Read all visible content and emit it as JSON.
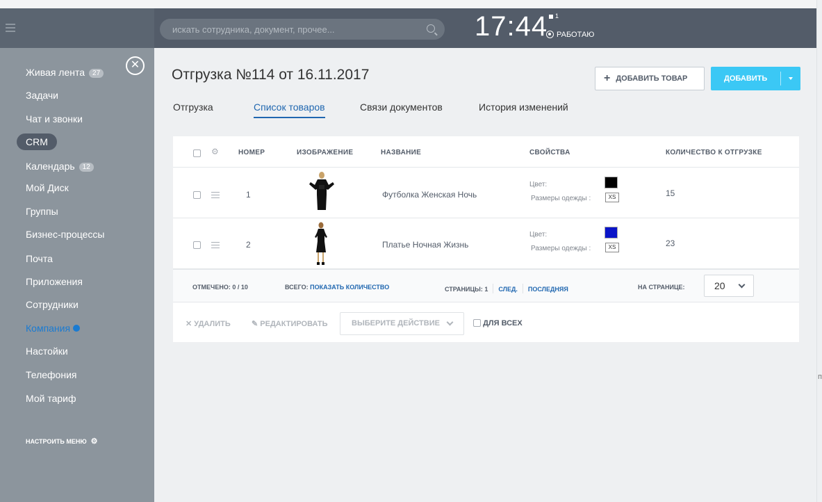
{
  "topbar": {
    "search_placeholder": "искать сотрудника, документ, прочее...",
    "clock": "17:44",
    "notification_count": "1",
    "status": "РАБОТАЮ"
  },
  "sidebar": {
    "items": [
      {
        "label": "Живая лента",
        "counter": "27"
      },
      {
        "label": "Задачи"
      },
      {
        "label": "Чат и звонки"
      },
      {
        "label": "CRM"
      },
      {
        "label": "Календарь",
        "counter": "12"
      },
      {
        "label": "Мой Диск"
      },
      {
        "label": "Группы"
      },
      {
        "label": "Бизнес-процессы"
      },
      {
        "label": "Почта"
      },
      {
        "label": "Приложения"
      },
      {
        "label": "Сотрудники"
      },
      {
        "label": "Компания"
      },
      {
        "label": "Настойки"
      },
      {
        "label": "Телефония"
      },
      {
        "label": "Мой тариф"
      }
    ],
    "configure_menu": "НАСТРОИТЬ МЕНЮ"
  },
  "header": {
    "title": "Отгрузка №114 от 16.11.2017",
    "add_product_label": "ДОБАВИТЬ ТОВАР",
    "add_label": "ДОБАВИТЬ"
  },
  "tabs": [
    {
      "label": "Отгрузка"
    },
    {
      "label": "Список товаров",
      "active": true
    },
    {
      "label": "Связи документов"
    },
    {
      "label": "История изменений"
    }
  ],
  "table": {
    "columns": [
      "НОМЕР",
      "ИЗОБРАЖЕНИЕ",
      "НАЗВАНИЕ",
      "СВОЙСТВА",
      "КОЛИЧЕСТВО К ОТГРУЗКЕ"
    ],
    "rows": [
      {
        "number": "1",
        "name": "Футболка Женская Ночь",
        "color_label": "Цвет:",
        "color": "#000000",
        "size_label": "Размеры одежды :",
        "size": "XS",
        "quantity": "15"
      },
      {
        "number": "2",
        "name": "Платье Ночная Жизнь",
        "color_label": "Цвет:",
        "color": "#0a14c8",
        "size_label": "Размеры одежды :",
        "size": "XS",
        "quantity": "23"
      }
    ]
  },
  "footer": {
    "selected_label": "ОТМЕЧЕНО:",
    "selected_value": "0 / 10",
    "total_label": "ВСЕГО:",
    "total_link": "ПОКАЗАТЬ КОЛИЧЕСТВО",
    "pages_label": "СТРАНИЦЫ:",
    "pages_value": "1",
    "next": "СЛЕД.",
    "last": "ПОСЛЕДНЯЯ",
    "per_page_label": "НА СТРАНИЦЕ:",
    "per_page_value": "20"
  },
  "actions": {
    "delete": "УДАЛИТЬ",
    "edit": "РЕДАКТИРОВАТЬ",
    "select_action": "ВЫБЕРИТЕ ДЕЙСТВИЕ",
    "for_all": "ДЛЯ ВСЕХ"
  },
  "right_edge_letter": "п",
  "colors": {
    "topbar": "#535c69",
    "sidebar": "#8c959d",
    "accent": "#3bc8f5",
    "link": "#2067b0"
  }
}
